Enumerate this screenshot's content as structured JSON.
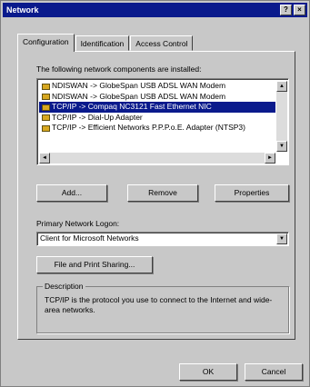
{
  "window": {
    "title": "Network",
    "help_glyph": "?",
    "close_glyph": "×"
  },
  "tabs": [
    {
      "label": "Configuration",
      "active": true
    },
    {
      "label": "Identification",
      "active": false
    },
    {
      "label": "Access Control",
      "active": false
    }
  ],
  "components": {
    "label": "The following network components are installed:",
    "items": [
      {
        "label": "NDISWAN -> GlobeSpan USB ADSL WAN Modem",
        "selected": false
      },
      {
        "label": "NDISWAN -> GlobeSpan USB ADSL WAN Modem",
        "selected": false
      },
      {
        "label": "TCP/IP -> Compaq NC3121 Fast Ethernet NIC",
        "selected": true
      },
      {
        "label": "TCP/IP -> Dial-Up Adapter",
        "selected": false
      },
      {
        "label": "TCP/IP -> Efficient Networks P.P.P.o.E. Adapter (NTSP3)",
        "selected": false
      }
    ]
  },
  "buttons": {
    "add": "Add...",
    "remove": "Remove",
    "properties": "Properties",
    "file_print": "File and Print Sharing...",
    "ok": "OK",
    "cancel": "Cancel"
  },
  "logon": {
    "label": "Primary Network Logon:",
    "value": "Client for Microsoft Networks"
  },
  "description": {
    "title": "Description",
    "text": "TCP/IP is the protocol you use to connect to the Internet and wide-area networks."
  },
  "scroll_glyphs": {
    "up": "▲",
    "down": "▼",
    "left": "◄",
    "right": "►"
  },
  "colors": {
    "titlebar": "#0a1a8c",
    "selection": "#0a1a8c",
    "face": "#c8c8c8"
  }
}
